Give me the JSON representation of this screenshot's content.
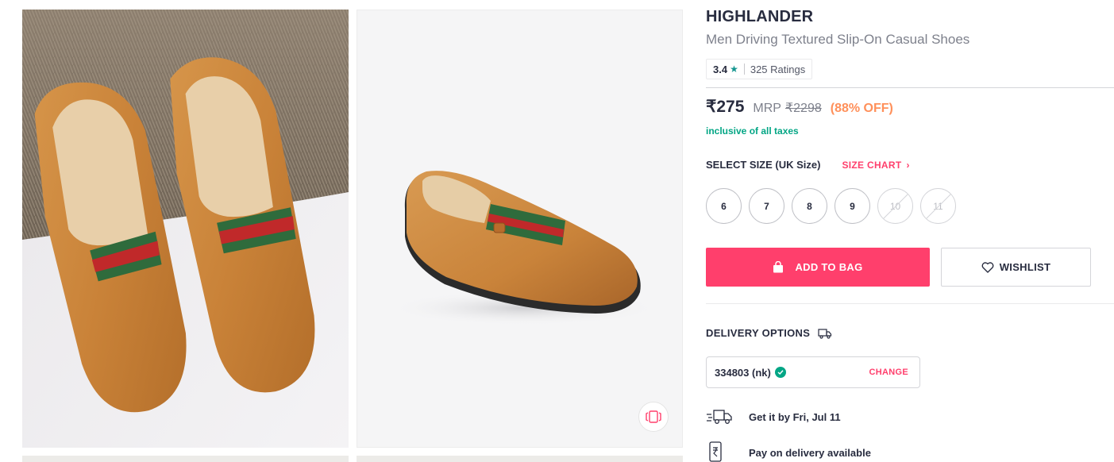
{
  "product": {
    "brand": "HIGHLANDER",
    "name": "Men Driving Textured Slip-On Casual Shoes",
    "rating": {
      "value": "3.4",
      "star": "★",
      "count": "325 Ratings"
    },
    "price": "₹275",
    "mrp_label": "MRP",
    "mrp": "₹2298",
    "discount": "(88% OFF)",
    "tax_note": "inclusive of all taxes"
  },
  "gallery": {
    "images": [
      "shoe-pair-photo",
      "single-shoe-photo"
    ],
    "similar_icon": "similar-products-icon"
  },
  "size": {
    "title": "SELECT SIZE (UK Size)",
    "chart_label": "SIZE CHART",
    "options": [
      {
        "label": "6",
        "available": true
      },
      {
        "label": "7",
        "available": true
      },
      {
        "label": "8",
        "available": true
      },
      {
        "label": "9",
        "available": true
      },
      {
        "label": "10",
        "available": false
      },
      {
        "label": "11",
        "available": false
      }
    ]
  },
  "actions": {
    "add_to_bag": "ADD TO BAG",
    "wishlist": "WISHLIST"
  },
  "delivery": {
    "title": "DELIVERY OPTIONS",
    "pincode": "334803 (nk)",
    "change_label": "CHANGE",
    "date_text": "Get it by Fri, Jul 11",
    "payment_text": "Pay on delivery available"
  },
  "colors": {
    "accent": "#ff3f6c",
    "discount": "#ff905a",
    "success": "#03a685",
    "text": "#282c3f",
    "muted": "#7e818c"
  }
}
